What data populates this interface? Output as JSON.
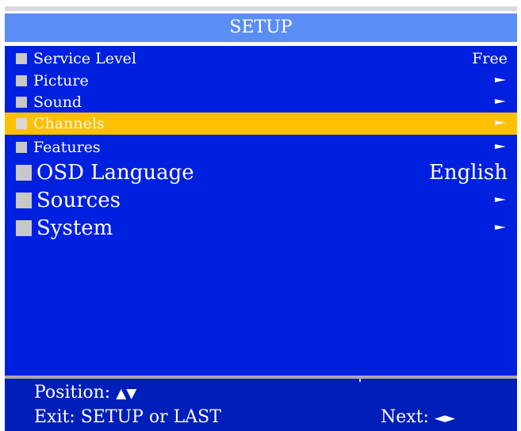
{
  "header": {
    "title": "SETUP"
  },
  "menu": {
    "items": [
      {
        "label": "Service Level",
        "value": "Free"
      },
      {
        "label": "Picture",
        "arrow": "►"
      },
      {
        "label": "Sound",
        "arrow": "►"
      },
      {
        "label": "Channels",
        "arrow": "►",
        "selected": true
      },
      {
        "label": "Features",
        "arrow": "►"
      },
      {
        "label": "OSD Language",
        "value": "English"
      },
      {
        "label": "Sources",
        "arrow": "►"
      },
      {
        "label": "System",
        "arrow": "►"
      }
    ]
  },
  "footer": {
    "position_label": "Position:",
    "position_icon": "▲▼",
    "exit_label": "Exit: SETUP or LAST",
    "next_label": "Next:",
    "next_icon": "◄►"
  },
  "colors": {
    "title_bar": "#5b8ef5",
    "menu_background": "#0020e0",
    "selection_highlight": "#ffc000",
    "footer_background": "#001eb8",
    "bullet": "#c8c8c8",
    "text": "#ffffff"
  },
  "icons": {
    "bullet": "square-bullet-icon",
    "submenu": "right-arrow-icon",
    "position": "up-down-arrows-icon",
    "next": "left-right-arrows-icon"
  }
}
